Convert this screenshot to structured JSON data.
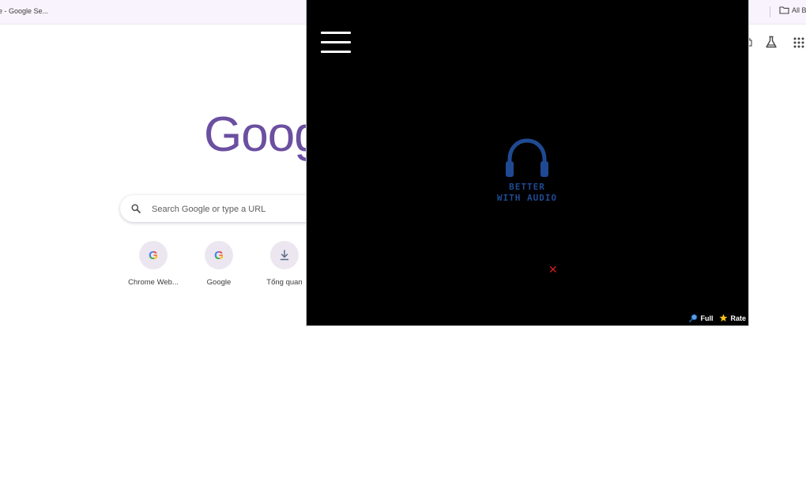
{
  "browser": {
    "tab_title": "e - Google Se...",
    "bookmarks": {
      "all_bookmarks_label": "All B"
    },
    "icons": [
      "folder-icon",
      "extension-icon",
      "labs-flask-icon",
      "apps-grid-icon"
    ]
  },
  "ntp": {
    "logo_text": "Goog",
    "search": {
      "placeholder": "Search Google or type a URL"
    },
    "shortcuts": [
      {
        "label": "Chrome Web...",
        "icon": "G",
        "icon_name": "google-g-icon"
      },
      {
        "label": "Google",
        "icon": "G",
        "icon_name": "google-g-icon"
      },
      {
        "label": "Tổng quan",
        "icon_name": "download-icon"
      }
    ]
  },
  "overlay": {
    "audio_line1": "BETTER",
    "audio_line2": "WITH AUDIO",
    "close_symbol": "✕",
    "full_label": "Full",
    "rate_label": "Rate",
    "colors": {
      "background": "#000000",
      "audio_accent": "#1f4a93",
      "close": "#d42020"
    }
  }
}
